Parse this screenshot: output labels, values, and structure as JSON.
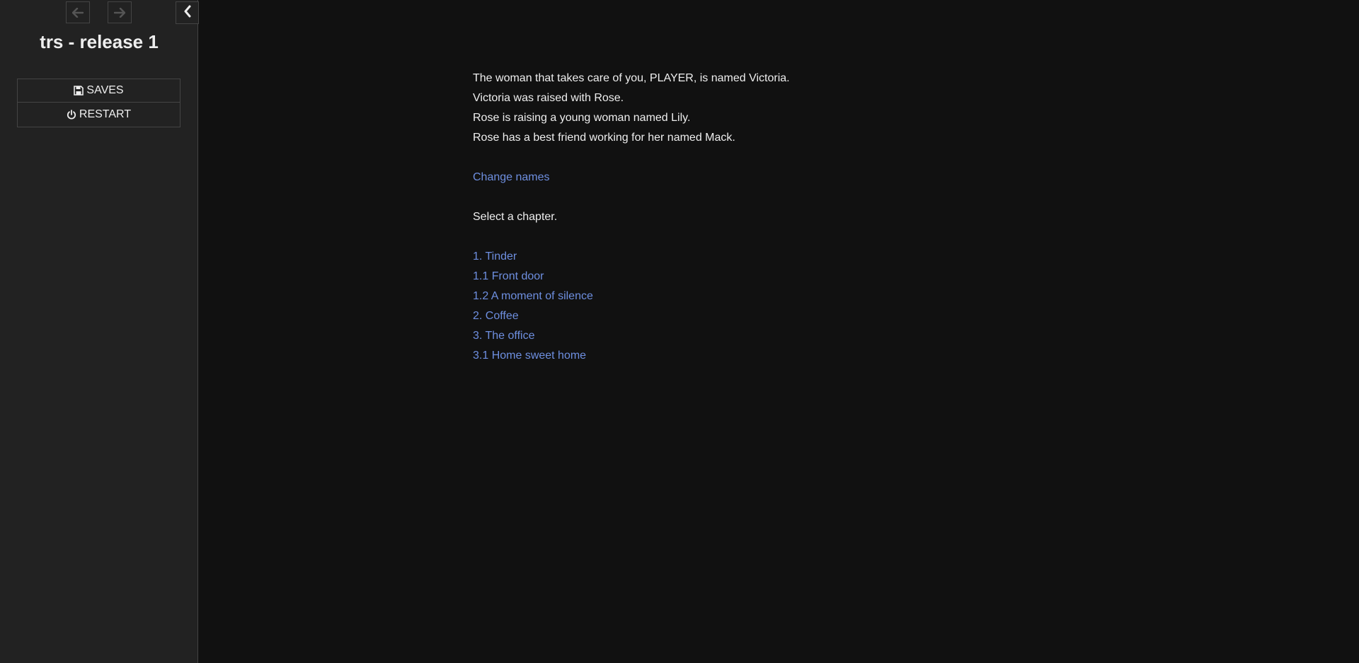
{
  "ui_bar": {
    "title": "trs - release 1",
    "back_icon": "arrow-left-icon",
    "forward_icon": "arrow-right-icon",
    "stow_icon": "chevron-left-icon",
    "menu": [
      {
        "label": "SAVES",
        "icon": "floppy-disk-icon"
      },
      {
        "label": "RESTART",
        "icon": "power-icon"
      }
    ]
  },
  "passage": {
    "intro_lines": [
      "The woman that takes care of you, PLAYER, is named Victoria.",
      "Victoria was raised with Rose.",
      "Rose is raising a young woman named Lily.",
      "Rose has a best friend working for her named Mack."
    ],
    "change_names_link": "Change names",
    "select_prompt": "Select a chapter.",
    "chapters": [
      "1. Tinder",
      "1.1 Front door",
      "1.2 A moment of silence",
      "2. Coffee",
      "3. The office",
      "3.1 Home sweet home"
    ]
  },
  "colors": {
    "background": "#111111",
    "sidebar": "#222222",
    "text": "#eeeeee",
    "link": "#6e8fe0"
  }
}
